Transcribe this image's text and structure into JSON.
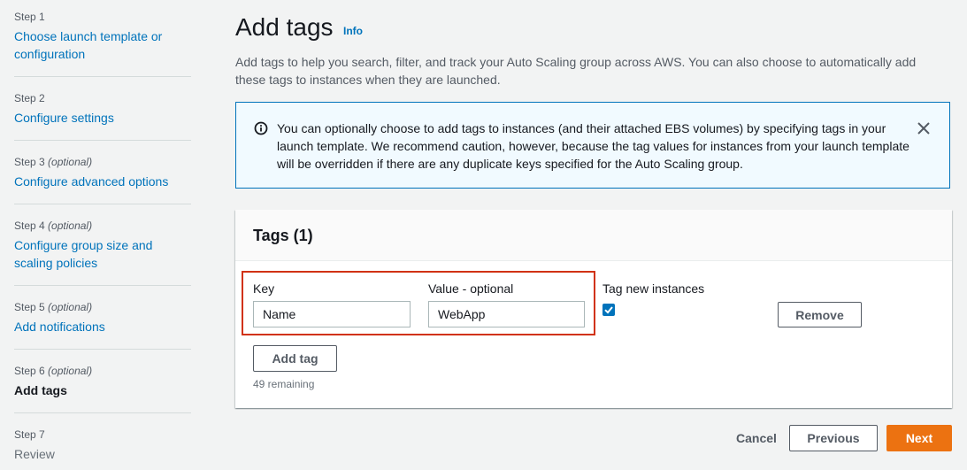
{
  "sidebar": {
    "steps": [
      {
        "label": "Step 1",
        "optional": "",
        "title_line1": "Choose launch template or",
        "title_line2": "configuration"
      },
      {
        "label": "Step 2",
        "optional": "",
        "title_line1": "Configure settings",
        "title_line2": ""
      },
      {
        "label": "Step 3",
        "optional": "(optional)",
        "title_line1": "Configure advanced options",
        "title_line2": ""
      },
      {
        "label": "Step 4",
        "optional": "(optional)",
        "title_line1": "Configure group size and",
        "title_line2": "scaling policies"
      },
      {
        "label": "Step 5",
        "optional": "(optional)",
        "title_line1": "Add notifications",
        "title_line2": ""
      },
      {
        "label": "Step 6",
        "optional": "(optional)",
        "title_line1": "Add tags",
        "title_line2": ""
      },
      {
        "label": "Step 7",
        "optional": "",
        "title_line1": "Review",
        "title_line2": ""
      }
    ]
  },
  "header": {
    "title": "Add tags",
    "info_link": "Info",
    "description": "Add tags to help you search, filter, and track your Auto Scaling group across AWS. You can also choose to automatically add these tags to instances when they are launched."
  },
  "alert": {
    "icon": "info-circle-icon",
    "text": "You can optionally choose to add tags to instances (and their attached EBS volumes) by specifying tags in your launch template. We recommend caution, however, because the tag values for instances from your launch template will be overridden if there are any duplicate keys specified for the Auto Scaling group."
  },
  "tags_panel": {
    "title": "Tags (1)",
    "key_label": "Key",
    "value_label": "Value - optional",
    "tag_new_instances_label": "Tag new instances",
    "rows": [
      {
        "key": "Name",
        "value": "WebApp",
        "tag_new_instances": true
      }
    ],
    "remove_button": "Remove",
    "add_tag_button": "Add tag",
    "remaining": "49 remaining"
  },
  "footer": {
    "cancel": "Cancel",
    "previous": "Previous",
    "next": "Next"
  },
  "colors": {
    "link": "#0073bb",
    "primary_button": "#ec7211",
    "highlight_border": "#d13212",
    "alert_background": "#f1faff"
  }
}
